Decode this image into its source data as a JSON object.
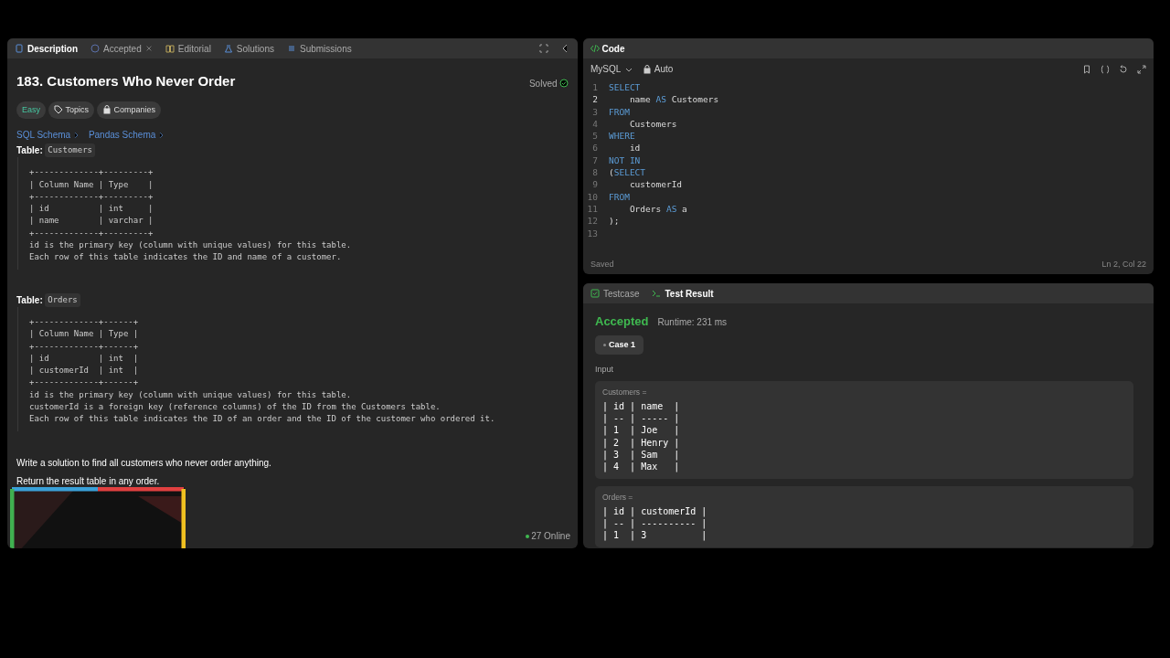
{
  "left_panel": {
    "tabs": [
      {
        "label": "Description",
        "selected": true,
        "closable": false
      },
      {
        "label": "Accepted",
        "selected": false,
        "closable": true
      },
      {
        "label": "Editorial",
        "selected": false,
        "closable": false
      },
      {
        "label": "Solutions",
        "selected": false,
        "closable": false
      },
      {
        "label": "Submissions",
        "selected": false,
        "closable": false
      }
    ],
    "problem": {
      "title": "183. Customers Who Never Order",
      "status": "Solved",
      "difficulty": "Easy",
      "tags": [
        "Topics",
        "Companies"
      ],
      "schema_links": [
        "SQL Schema",
        "Pandas Schema"
      ],
      "tables": [
        {
          "label": "Table:",
          "name": "Customers",
          "schema": "+-------------+---------+\n| Column Name | Type    |\n+-------------+---------+\n| id          | int     |\n| name        | varchar |\n+-------------+---------+\nid is the primary key (column with unique values) for this table.\nEach row of this table indicates the ID and name of a customer."
        },
        {
          "label": "Table:",
          "name": "Orders",
          "schema": "+-------------+------+\n| Column Name | Type |\n+-------------+------+\n| id          | int  |\n| customerId  | int  |\n+-------------+------+\nid is the primary key (column with unique values) for this table.\ncustomerId is a foreign key (reference columns) of the ID from the Customers table.\nEach row of this table indicates the ID of an order and the ID of the customer who ordered it."
        }
      ],
      "paragraphs": [
        "Write a solution to find all customers who never order anything.",
        "Return the result table in any order."
      ]
    },
    "online": "27 Online"
  },
  "code_panel": {
    "title": "Code",
    "language": "MySQL",
    "mode": "Auto",
    "lines": [
      {
        "number": "1",
        "current": false,
        "tokens": [
          {
            "text": "SELECT",
            "kind": "keyword"
          }
        ]
      },
      {
        "number": "2",
        "current": true,
        "tokens": [
          {
            "text": "    name ",
            "kind": "plain"
          },
          {
            "text": "AS",
            "kind": "keyword"
          },
          {
            "text": " Customers",
            "kind": "plain"
          }
        ]
      },
      {
        "number": "3",
        "current": false,
        "tokens": [
          {
            "text": "FROM",
            "kind": "keyword"
          }
        ]
      },
      {
        "number": "4",
        "current": false,
        "tokens": [
          {
            "text": "    Customers",
            "kind": "plain"
          }
        ]
      },
      {
        "number": "5",
        "current": false,
        "tokens": [
          {
            "text": "WHERE",
            "kind": "keyword"
          }
        ]
      },
      {
        "number": "6",
        "current": false,
        "tokens": [
          {
            "text": "    id",
            "kind": "plain"
          }
        ]
      },
      {
        "number": "7",
        "current": false,
        "tokens": [
          {
            "text": "NOT IN",
            "kind": "keyword"
          }
        ]
      },
      {
        "number": "8",
        "current": false,
        "tokens": [
          {
            "text": "(",
            "kind": "plain"
          },
          {
            "text": "SELECT",
            "kind": "keyword"
          }
        ]
      },
      {
        "number": "9",
        "current": false,
        "tokens": [
          {
            "text": "    customerId",
            "kind": "plain"
          }
        ]
      },
      {
        "number": "10",
        "current": false,
        "tokens": [
          {
            "text": "FROM",
            "kind": "keyword"
          }
        ]
      },
      {
        "number": "11",
        "current": false,
        "tokens": [
          {
            "text": "    Orders ",
            "kind": "plain"
          },
          {
            "text": "AS",
            "kind": "keyword"
          },
          {
            "text": " a",
            "kind": "plain"
          }
        ]
      },
      {
        "number": "12",
        "current": false,
        "tokens": [
          {
            "text": ");",
            "kind": "plain"
          }
        ]
      },
      {
        "number": "13",
        "current": false
      }
    ],
    "save_status": "Saved",
    "cursor": "Ln 2, Col 22"
  },
  "result_panel": {
    "tabs": [
      {
        "label": "Testcase",
        "selected": false
      },
      {
        "label": "Test Result",
        "selected": true
      }
    ],
    "verdict": "Accepted",
    "runtime": "Runtime: 231 ms",
    "cases": [
      {
        "label": "Case 1",
        "selected": true
      }
    ],
    "input_label": "Input",
    "inputs": [
      {
        "name": "Customers =",
        "value": "| id | name  |\n| -- | ----- |\n| 1  | Joe   |\n| 2  | Henry |\n| 3  | Sam   |\n| 4  | Max   |"
      },
      {
        "name": "Orders =",
        "value": "| id | customerId |\n| -- | ---------- |\n| 1  | 3          |"
      }
    ]
  }
}
